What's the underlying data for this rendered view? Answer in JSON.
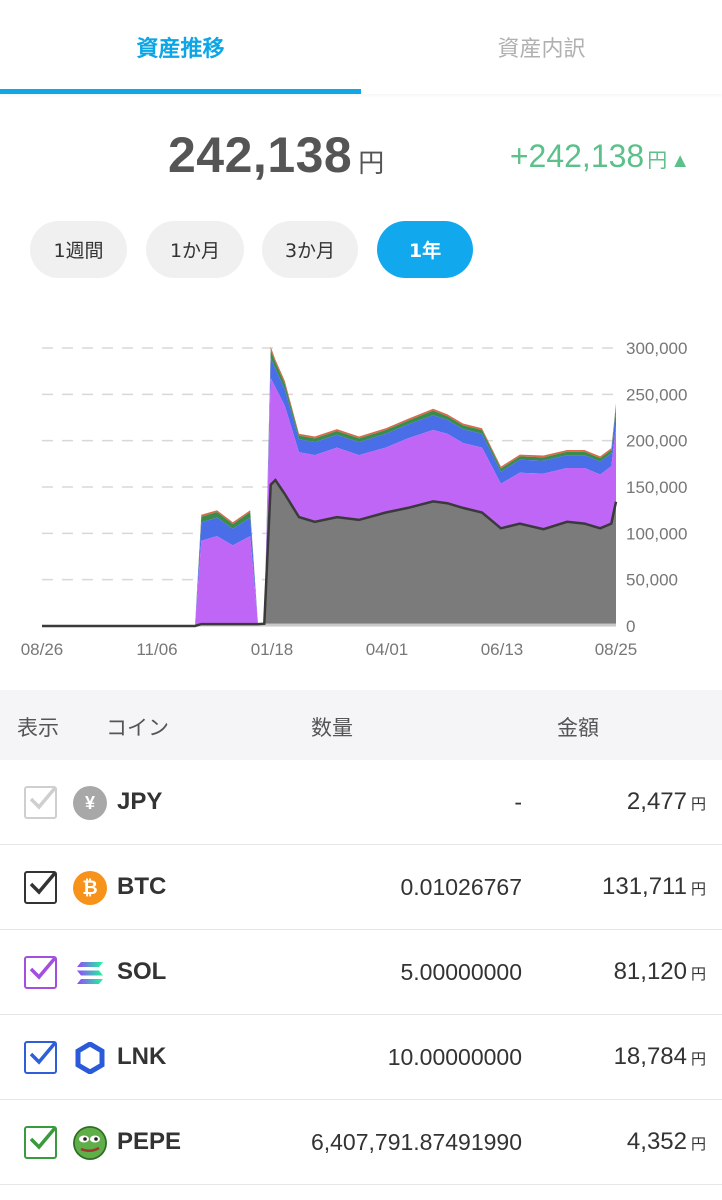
{
  "tabs": [
    {
      "label": "資産推移",
      "active": true
    },
    {
      "label": "資産内訳",
      "active": false
    }
  ],
  "summary": {
    "total": "242,138",
    "total_unit": "円",
    "change": "+242,138",
    "change_unit": "円",
    "change_arrow": "▲",
    "change_color": "#5cc08a"
  },
  "periods": [
    {
      "label": "1週間",
      "selected": false
    },
    {
      "label": "1か月",
      "selected": false
    },
    {
      "label": "3か月",
      "selected": false
    },
    {
      "label": "1年",
      "selected": true
    }
  ],
  "chart_data": {
    "type": "area",
    "stacked": true,
    "ylim": [
      0,
      300000
    ],
    "y_ticks": [
      "300,000",
      "250,000",
      "200,000",
      "150,000",
      "100,000",
      "50,000",
      "0"
    ],
    "y_tick_values": [
      300000,
      250000,
      200000,
      150000,
      100000,
      50000,
      0
    ],
    "x_tick_labels": [
      "08/26",
      "11/06",
      "01/18",
      "04/01",
      "06/13",
      "08/25"
    ],
    "x": [
      "08/26",
      "10/01",
      "11/06",
      "12/01",
      "12/05",
      "12/15",
      "12/25",
      "01/05",
      "01/10",
      "01/14",
      "01/18",
      "01/21",
      "01/27",
      "02/05",
      "02/15",
      "03/01",
      "03/15",
      "04/01",
      "04/15",
      "05/01",
      "05/10",
      "05/20",
      "06/01",
      "06/13",
      "06/25",
      "07/10",
      "07/25",
      "08/05",
      "08/15",
      "08/22",
      "08/25"
    ],
    "series": [
      {
        "name": "JPY",
        "color": "#c8c8c8",
        "values": [
          0,
          0,
          0,
          0,
          2000,
          2000,
          2000,
          2000,
          2000,
          2477,
          2477,
          2477,
          2477,
          2477,
          2477,
          2477,
          2477,
          2477,
          2477,
          2477,
          2477,
          2477,
          2477,
          2477,
          2477,
          2477,
          2477,
          2477,
          2477,
          2477,
          2477
        ]
      },
      {
        "name": "BTC",
        "color": "#7b7b7b",
        "values": [
          0,
          0,
          0,
          0,
          0,
          0,
          0,
          0,
          0,
          0,
          150000,
          155000,
          140000,
          115000,
          110000,
          115000,
          112000,
          120000,
          125000,
          132000,
          130000,
          125000,
          120000,
          103000,
          108000,
          102000,
          110000,
          108000,
          103000,
          108000,
          131711
        ]
      },
      {
        "name": "SOL",
        "color": "#c066f7",
        "values": [
          0,
          0,
          0,
          0,
          90000,
          95000,
          85000,
          95000,
          0,
          0,
          115000,
          100000,
          95000,
          70000,
          72000,
          75000,
          70000,
          70000,
          75000,
          77000,
          75000,
          70000,
          70000,
          48000,
          55000,
          60000,
          58000,
          60000,
          58000,
          62000,
          81120
        ]
      },
      {
        "name": "LNK",
        "color": "#4a6ee8",
        "values": [
          0,
          0,
          0,
          0,
          20000,
          20000,
          18000,
          20000,
          0,
          0,
          22000,
          20000,
          18000,
          14000,
          14000,
          14000,
          14000,
          15000,
          15000,
          16000,
          15000,
          15000,
          15000,
          13000,
          14000,
          14000,
          14000,
          14000,
          14000,
          14000,
          18784
        ]
      },
      {
        "name": "PEPE",
        "color": "#3a8c4a",
        "values": [
          0,
          0,
          0,
          0,
          6000,
          6000,
          5000,
          6000,
          0,
          0,
          8000,
          7000,
          6000,
          4000,
          4000,
          4000,
          4000,
          4000,
          4000,
          5000,
          4000,
          4000,
          4000,
          3500,
          3500,
          3500,
          3500,
          3500,
          3500,
          3500,
          4352
        ]
      },
      {
        "name": "other",
        "color": "#d96a4e",
        "values": [
          0,
          0,
          0,
          0,
          2000,
          2000,
          2000,
          2000,
          0,
          0,
          4000,
          3000,
          3000,
          2000,
          2000,
          2000,
          2000,
          2000,
          2000,
          2000,
          2000,
          2000,
          2000,
          2000,
          2000,
          2000,
          2000,
          2000,
          2000,
          2000,
          2000
        ]
      }
    ]
  },
  "table": {
    "headers": {
      "show": "表示",
      "coin": "コイン",
      "quantity": "数量",
      "amount": "金額"
    },
    "rows": [
      {
        "symbol": "JPY",
        "quantity": "-",
        "amount": "2,477",
        "unit": "円",
        "checked": true,
        "check_color": "#cfcfcf",
        "icon": "yen-icon",
        "icon_glyph": "¥",
        "icon_color": "#a8a8a8"
      },
      {
        "symbol": "BTC",
        "quantity": "0.01026767",
        "amount": "131,711",
        "unit": "円",
        "checked": true,
        "check_color": "#333333",
        "icon": "bitcoin-icon",
        "icon_glyph": "₿",
        "icon_color": "#f7931a"
      },
      {
        "symbol": "SOL",
        "quantity": "5.00000000",
        "amount": "81,120",
        "unit": "円",
        "checked": true,
        "check_color": "#a24ee0",
        "icon": "solana-icon",
        "icon_glyph": "",
        "icon_color": "#9945ff"
      },
      {
        "symbol": "LNK",
        "quantity": "10.00000000",
        "amount": "18,784",
        "unit": "円",
        "checked": true,
        "check_color": "#2f5fd8",
        "icon": "chainlink-icon",
        "icon_glyph": "",
        "icon_color": "#2a5ada"
      },
      {
        "symbol": "PEPE",
        "quantity": "6,407,791.87491990",
        "amount": "4,352",
        "unit": "円",
        "checked": true,
        "check_color": "#3a9a3e",
        "icon": "pepe-icon",
        "icon_glyph": "",
        "icon_color": "#4c9a40"
      }
    ]
  }
}
